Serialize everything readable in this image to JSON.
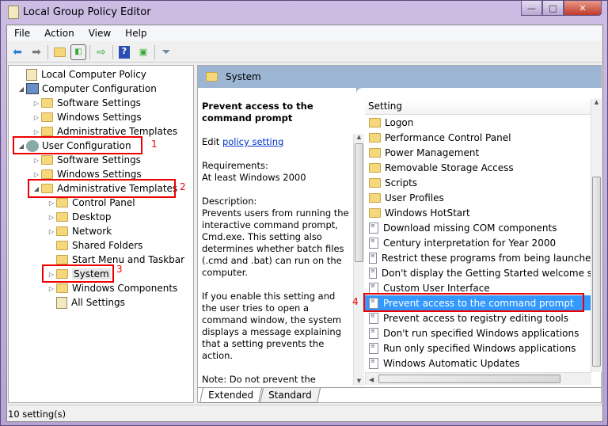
{
  "window": {
    "title": "Local Group Policy Editor",
    "controls": {
      "minimize": "—",
      "maximize": "□",
      "close": "✕"
    }
  },
  "menu": [
    "File",
    "Action",
    "View",
    "Help"
  ],
  "toolbar": [
    "back-icon",
    "forward-icon",
    "up-folder-icon",
    "show-hide-console-tree-icon",
    "export-list-icon",
    "help-icon",
    "show-action-pane-icon",
    "filter-icon"
  ],
  "tree": [
    {
      "label": "Local Computer Policy",
      "exp": ""
    },
    {
      "label": "Computer Configuration",
      "exp": "◢"
    },
    {
      "label": "Software Settings",
      "exp": "▷"
    },
    {
      "label": "Windows Settings",
      "exp": "▷"
    },
    {
      "label": "Administrative Templates",
      "exp": "▷"
    },
    {
      "label": "User Configuration",
      "exp": "◢"
    },
    {
      "label": "Software Settings",
      "exp": "▷"
    },
    {
      "label": "Windows Settings",
      "exp": "▷"
    },
    {
      "label": "Administrative Templates",
      "exp": "◢"
    },
    {
      "label": "Control Panel",
      "exp": "▷"
    },
    {
      "label": "Desktop",
      "exp": "▷"
    },
    {
      "label": "Network",
      "exp": "▷"
    },
    {
      "label": "Shared Folders",
      "exp": ""
    },
    {
      "label": "Start Menu and Taskbar",
      "exp": ""
    },
    {
      "label": "System",
      "exp": "▷"
    },
    {
      "label": "Windows Components",
      "exp": "▷"
    },
    {
      "label": "All Settings",
      "exp": ""
    }
  ],
  "annotations": [
    "1",
    "2",
    "3",
    "4"
  ],
  "annotation_color": "#e00000",
  "right": {
    "header": "System",
    "desc": {
      "title": "Prevent access to the command prompt",
      "edit_prefix": "Edit ",
      "edit_link": "policy setting",
      "requirements_label": "Requirements:",
      "requirements": "At least Windows 2000",
      "description_label": "Description:",
      "description": "Prevents users from running the interactive command prompt, Cmd.exe. This setting also determines whether batch files (.cmd and .bat) can run on the computer.",
      "p2": "If you enable this setting and the user tries to open a command window, the system displays a message explaining that a setting prevents the action.",
      "p3": "Note: Do not prevent the computer from running batch"
    },
    "column": "Setting",
    "rows": [
      {
        "label": "Logon",
        "type": "folder"
      },
      {
        "label": "Performance Control Panel",
        "type": "folder"
      },
      {
        "label": "Power Management",
        "type": "folder"
      },
      {
        "label": "Removable Storage Access",
        "type": "folder"
      },
      {
        "label": "Scripts",
        "type": "folder"
      },
      {
        "label": "User Profiles",
        "type": "folder"
      },
      {
        "label": "Windows HotStart",
        "type": "folder"
      },
      {
        "label": "Download missing COM components",
        "type": "setting"
      },
      {
        "label": "Century interpretation for Year 2000",
        "type": "setting"
      },
      {
        "label": "Restrict these programs from being launched from Help",
        "type": "setting"
      },
      {
        "label": "Don't display the Getting Started welcome screen at logon",
        "type": "setting"
      },
      {
        "label": "Custom User Interface",
        "type": "setting"
      },
      {
        "label": "Prevent access to the command prompt",
        "type": "setting",
        "selected": true
      },
      {
        "label": "Prevent access to registry editing tools",
        "type": "setting"
      },
      {
        "label": "Don't run specified Windows applications",
        "type": "setting"
      },
      {
        "label": "Run only specified Windows applications",
        "type": "setting"
      },
      {
        "label": "Windows Automatic Updates",
        "type": "setting"
      }
    ],
    "tabs": [
      "Extended",
      "Standard"
    ],
    "selection_color": "#3399ff"
  },
  "status": "10 setting(s)"
}
